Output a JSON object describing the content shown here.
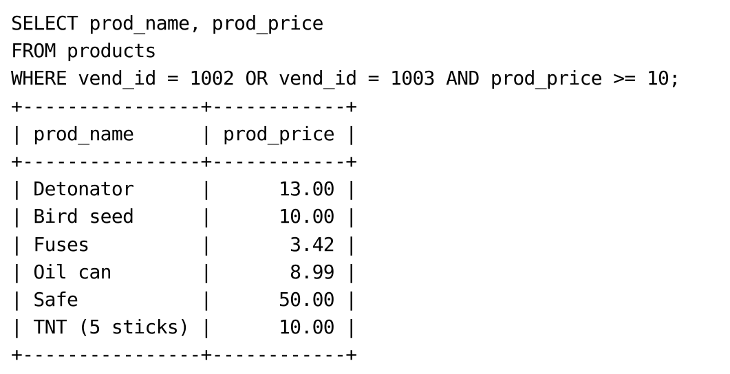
{
  "query": {
    "lines": [
      "SELECT prod_name, prod_price",
      "FROM products",
      "WHERE vend_id = 1002 OR vend_id = 1003 AND prod_price >= 10;"
    ]
  },
  "result": {
    "border": "+----------------+------------+",
    "header": "| prod_name      | prod_price |",
    "rows": [
      "| Detonator      |      13.00 |",
      "| Bird seed      |      10.00 |",
      "| Fuses          |       3.42 |",
      "| Oil can        |       8.99 |",
      "| Safe           |      50.00 |",
      "| TNT (5 sticks) |      10.00 |"
    ]
  }
}
